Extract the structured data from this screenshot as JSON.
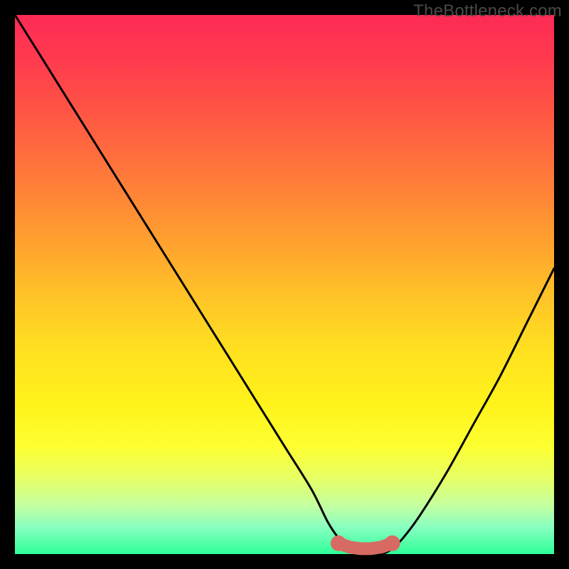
{
  "watermark": "TheBottleneck.com",
  "colors": {
    "frame": "#000000",
    "curve": "#000000",
    "marker_fill": "#d76a63",
    "marker_stroke": "#c35a54",
    "gradient_top": "#ff2a55",
    "gradient_bottom": "#2eff9a"
  },
  "chart_data": {
    "type": "line",
    "title": "",
    "xlabel": "",
    "ylabel": "",
    "xlim": [
      0,
      100
    ],
    "ylim": [
      0,
      100
    ],
    "grid": false,
    "legend": false,
    "series": [
      {
        "name": "bottleneck-curve",
        "x": [
          0,
          5,
          10,
          15,
          20,
          25,
          30,
          35,
          40,
          45,
          50,
          55,
          58,
          60,
          62,
          64,
          66,
          68,
          70,
          72,
          75,
          80,
          85,
          90,
          95,
          100
        ],
        "values": [
          100,
          92,
          84,
          76,
          68,
          60,
          52,
          44,
          36,
          28,
          20,
          12,
          6,
          3,
          1,
          0,
          0,
          0,
          1,
          3,
          7,
          15,
          24,
          33,
          43,
          53
        ]
      }
    ],
    "markers": {
      "name": "optimum-range",
      "x": [
        60,
        62,
        64,
        66,
        68,
        70
      ],
      "values": [
        2,
        1.3,
        1,
        1,
        1.3,
        2
      ]
    }
  }
}
